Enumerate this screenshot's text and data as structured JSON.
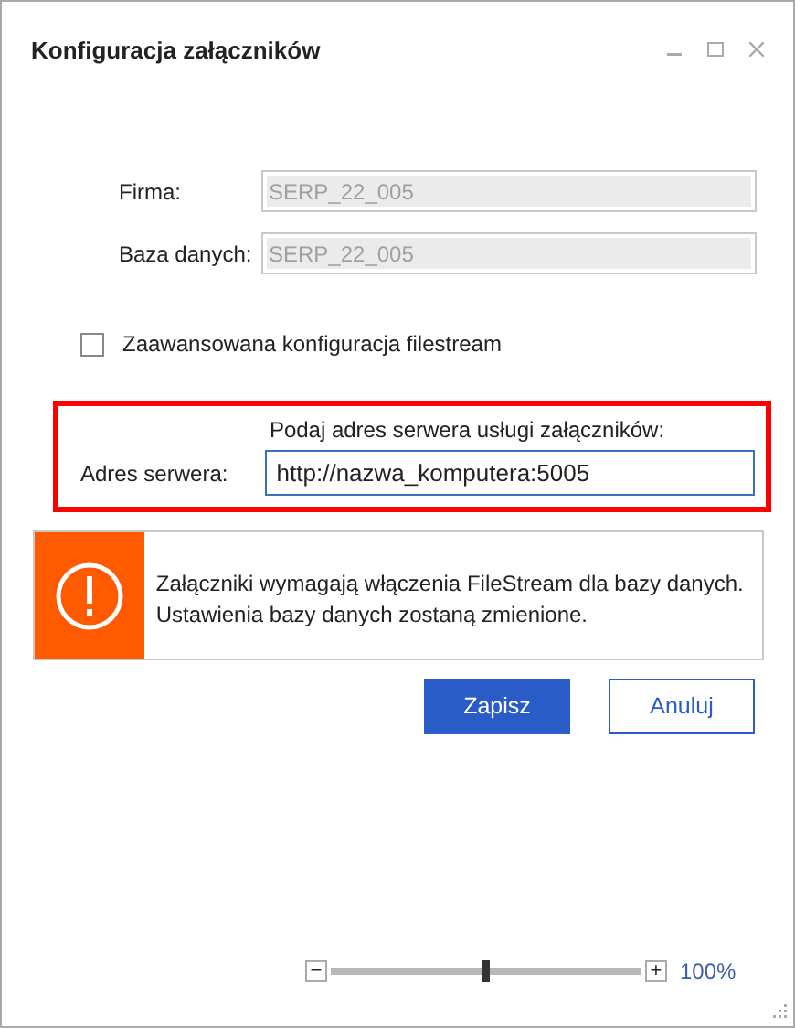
{
  "window": {
    "title": "Konfiguracja załączników"
  },
  "fields": [
    {
      "label": "Firma:",
      "value": "SERP_22_005",
      "disabled": true
    },
    {
      "label": "Baza danych:",
      "value": "SERP_22_005",
      "disabled": true
    }
  ],
  "advanced_checkbox": {
    "label": "Zaawansowana konfiguracja filestream",
    "checked": false
  },
  "server": {
    "prompt": "Podaj adres serwera usługi załączników:",
    "label": "Adres serwera:",
    "value": "http://nazwa_komputera:5005"
  },
  "alert": {
    "message": "Załączniki wymagają włączenia FileStream dla bazy danych. Ustawienia bazy danych zostaną zmienione."
  },
  "buttons": [
    {
      "label": "Zapisz",
      "kind": "primary"
    },
    {
      "label": "Anuluj",
      "kind": "secondary"
    }
  ],
  "zoom": {
    "minus": "−",
    "plus": "+",
    "level": 0.5,
    "reading": "100%"
  }
}
